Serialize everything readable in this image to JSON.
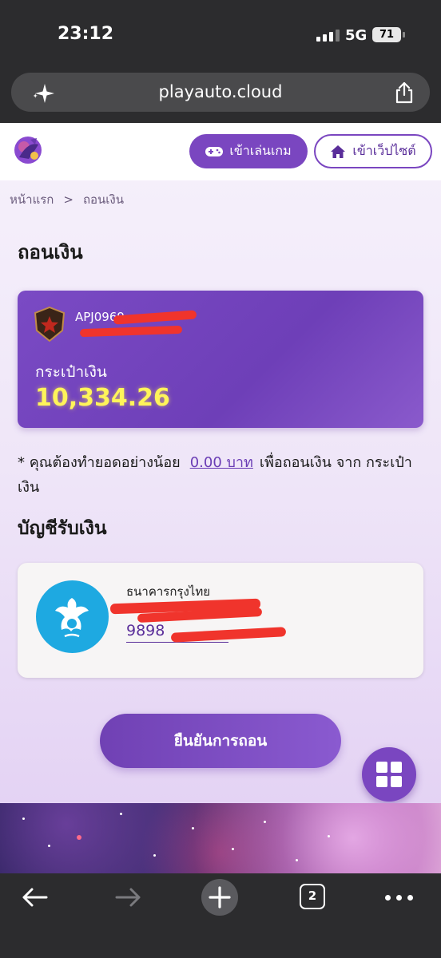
{
  "status_bar": {
    "time": "23:12",
    "network": "5G",
    "battery": "71"
  },
  "browser": {
    "url": "playauto.cloud",
    "tab_count": "2"
  },
  "header": {
    "play_button": "เข้าเล่นเกม",
    "site_button": "เข้าเว็ปไซต์"
  },
  "breadcrumb": {
    "home": "หน้าแรก",
    "separator": ">",
    "current": "ถอนเงิน"
  },
  "page_title": "ถอนเงิน",
  "wallet": {
    "username": "APJ0969",
    "label": "กระเป๋าเงิน",
    "balance": "10,334.26"
  },
  "notice": {
    "prefix": "* คุณต้องทำยอดอย่างน้อย",
    "amount": "0.00 บาท",
    "suffix": "เพื่อถอนเงิน จาก กระเป๋าเงิน"
  },
  "account_section": {
    "title": "บัญชีรับเงิน",
    "bank_name": "ธนาคารกรุงไทย",
    "account_number": "9898"
  },
  "confirm_button": "ยืนยันการถอน",
  "colors": {
    "primary": "#7a46c0",
    "balance": "#fff45a",
    "bank": "#1ea9e1",
    "redaction": "#f0342c"
  }
}
